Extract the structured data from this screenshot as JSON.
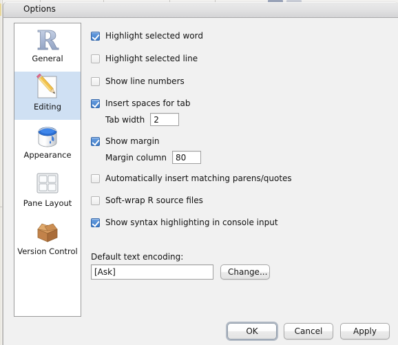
{
  "window": {
    "title": "Options"
  },
  "sidebar": {
    "items": [
      {
        "label": "General",
        "icon": "r-logo-icon",
        "selected": false
      },
      {
        "label": "Editing",
        "icon": "pencil-paper-icon",
        "selected": true
      },
      {
        "label": "Appearance",
        "icon": "paint-can-icon",
        "selected": false
      },
      {
        "label": "Pane Layout",
        "icon": "grid-panes-icon",
        "selected": false
      },
      {
        "label": "Version Control",
        "icon": "open-box-icon",
        "selected": false
      }
    ]
  },
  "editing_pane": {
    "checkboxes": [
      {
        "label": "Highlight selected word",
        "checked": true
      },
      {
        "label": "Highlight selected line",
        "checked": false
      },
      {
        "label": "Show line numbers",
        "checked": false
      },
      {
        "label": "Insert spaces for tab",
        "checked": true
      },
      {
        "label": "Show margin",
        "checked": true
      },
      {
        "label": "Automatically insert matching parens/quotes",
        "checked": false
      },
      {
        "label": "Soft-wrap R source files",
        "checked": false
      },
      {
        "label": "Show syntax highlighting in console input",
        "checked": true
      }
    ],
    "tab_width": {
      "label": "Tab width",
      "value": "2"
    },
    "margin_column": {
      "label": "Margin column",
      "value": "80"
    },
    "encoding": {
      "label": "Default text encoding:",
      "value": "[Ask]",
      "change_button": "Change..."
    }
  },
  "buttons": {
    "ok": "OK",
    "cancel": "Cancel",
    "apply": "Apply"
  },
  "colors": {
    "selection": "#cfe0f3",
    "checkbox_on": "#3d7cc9",
    "dialog_bg": "#f1f1f1",
    "titlebar_bg": "#e2e2e3"
  }
}
